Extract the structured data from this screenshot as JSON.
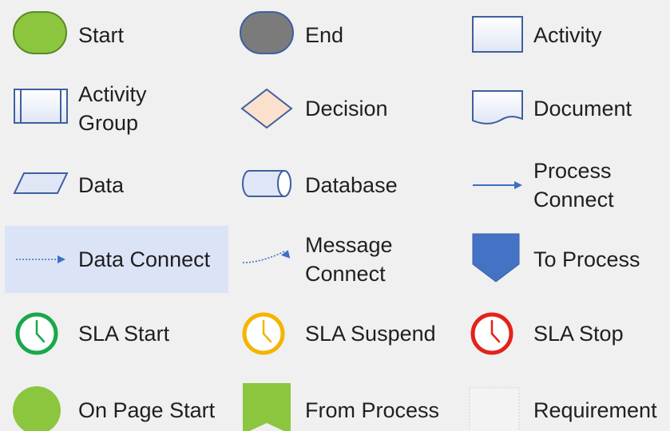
{
  "stencil": {
    "items": [
      {
        "label": "Start",
        "icon": "start-shape-icon",
        "selected": false
      },
      {
        "label": "End",
        "icon": "end-shape-icon",
        "selected": false
      },
      {
        "label": "Activity",
        "icon": "activity-shape-icon",
        "selected": false
      },
      {
        "label": "Activity\nGroup",
        "icon": "activity-group-shape-icon",
        "selected": false
      },
      {
        "label": "Decision",
        "icon": "decision-shape-icon",
        "selected": false
      },
      {
        "label": "Document",
        "icon": "document-shape-icon",
        "selected": false
      },
      {
        "label": "Data",
        "icon": "data-shape-icon",
        "selected": false
      },
      {
        "label": "Database",
        "icon": "database-shape-icon",
        "selected": false
      },
      {
        "label": "Process\nConnect",
        "icon": "process-connect-icon",
        "selected": false
      },
      {
        "label": "Data Connect",
        "icon": "data-connect-icon",
        "selected": true
      },
      {
        "label": "Message\nConnect",
        "icon": "message-connect-icon",
        "selected": false
      },
      {
        "label": "To Process",
        "icon": "to-process-icon",
        "selected": false
      },
      {
        "label": "SLA Start",
        "icon": "sla-start-clock-icon",
        "selected": false
      },
      {
        "label": "SLA Suspend",
        "icon": "sla-suspend-clock-icon",
        "selected": false
      },
      {
        "label": "SLA Stop",
        "icon": "sla-stop-clock-icon",
        "selected": false
      },
      {
        "label": "On Page Start",
        "icon": "on-page-start-icon",
        "selected": false
      },
      {
        "label": "From Process",
        "icon": "from-process-icon",
        "selected": false
      },
      {
        "label": "Requirement",
        "icon": "requirement-shape-icon",
        "selected": false
      }
    ]
  },
  "colors": {
    "start_green": "#8cc63f",
    "end_gray": "#7b7b7b",
    "shape_border": "#3f5f9f",
    "shape_fill": "#dfe6f5",
    "decision_fill": "#fbe1cd",
    "connector_blue": "#3d6fc4",
    "to_process_blue": "#4472c4",
    "sla_green": "#18a84b",
    "sla_yellow": "#f4b400",
    "sla_red": "#e2231a",
    "selection": "#dbe3f7"
  }
}
